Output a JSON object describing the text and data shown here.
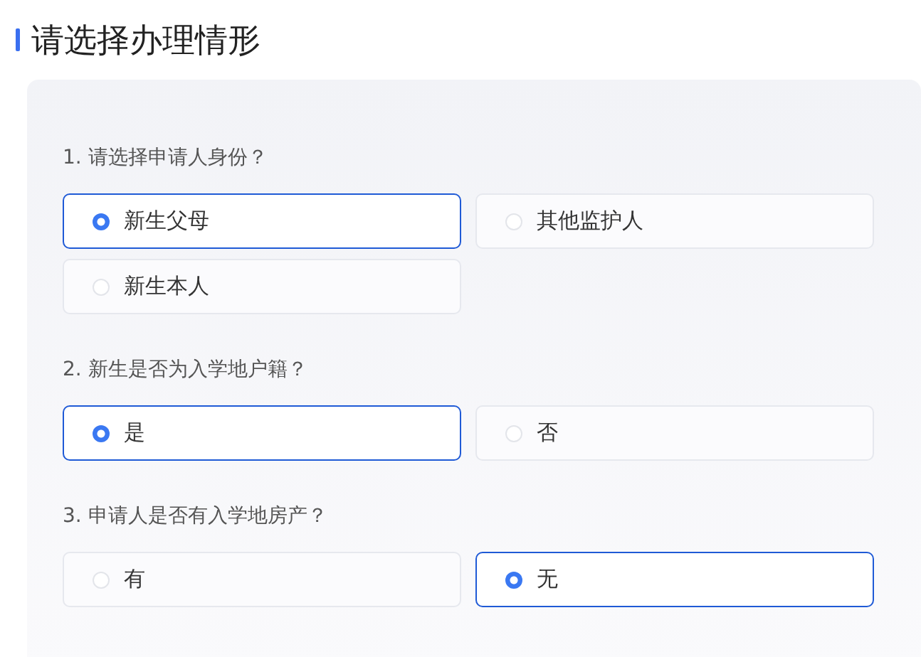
{
  "title": "请选择办理情形",
  "questions": [
    {
      "label": "1. 请选择申请人身份？",
      "options": [
        {
          "label": "新生父母",
          "selected": true
        },
        {
          "label": "其他监护人",
          "selected": false
        },
        {
          "label": "新生本人",
          "selected": false
        }
      ]
    },
    {
      "label": "2. 新生是否为入学地户籍？",
      "options": [
        {
          "label": "是",
          "selected": true
        },
        {
          "label": "否",
          "selected": false
        }
      ]
    },
    {
      "label": "3. 申请人是否有入学地房产？",
      "options": [
        {
          "label": "有",
          "selected": false
        },
        {
          "label": "无",
          "selected": true
        }
      ]
    }
  ]
}
